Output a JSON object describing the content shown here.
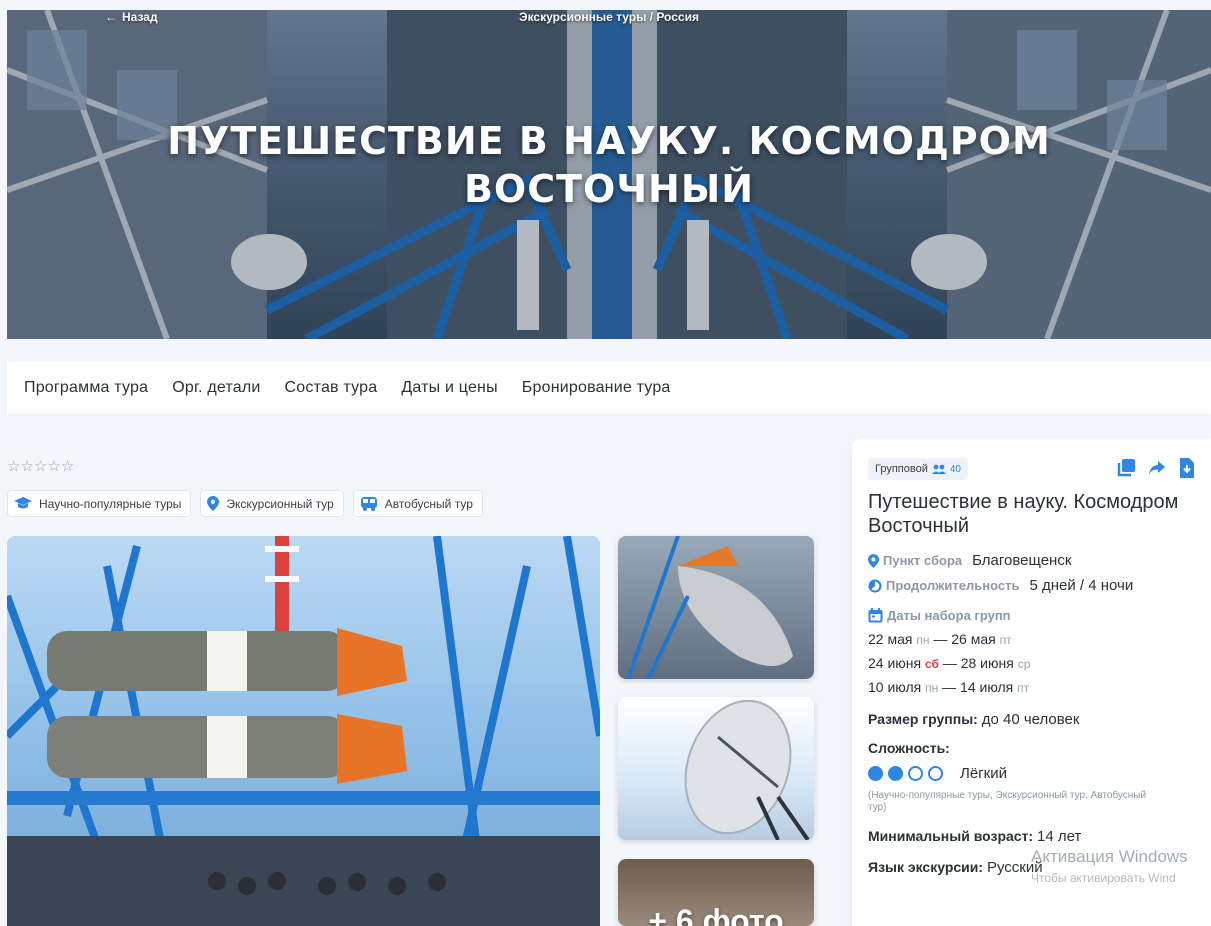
{
  "hero": {
    "back_label": "Назад",
    "breadcrumb": "Экскурсионные туры / Россия",
    "title": "ПУТЕШЕСТВИЕ В НАУКУ. КОСМОДРОМ ВОСТОЧНЫЙ"
  },
  "nav": {
    "items": [
      "Программа тура",
      "Орг. детали",
      "Состав тура",
      "Даты и цены",
      "Бронирование тура"
    ]
  },
  "rating": {
    "stars": "☆☆☆☆☆",
    "value": 0,
    "max": 5
  },
  "tags": [
    "Научно-популярные туры",
    "Экскурсионный тур",
    "Автобусный тур"
  ],
  "gallery": {
    "more_label": "+ 6 фото"
  },
  "panel": {
    "type_label": "Групповой",
    "group_count": "40",
    "title": "Путешествие в науку. Космодром Восточный",
    "meeting_label": "Пункт сбора",
    "meeting_value": "Благовещенск",
    "duration_label": "Продолжительность",
    "duration_value": "5 дней / 4 ночи",
    "dates_label": "Даты набора групп",
    "dates": [
      {
        "start": "22 мая",
        "start_dow": "пн",
        "end": "26 мая",
        "end_dow": "пт"
      },
      {
        "start": "24 июня",
        "start_dow": "сб",
        "end": "28 июня",
        "end_dow": "ср"
      },
      {
        "start": "10 июля",
        "start_dow": "пн",
        "end": "14 июля",
        "end_dow": "пт"
      }
    ],
    "dash": "—",
    "group_size_label": "Размер группы:",
    "group_size_value": "до 40 человек",
    "difficulty_label": "Сложность:",
    "difficulty_value": "Лёгкий",
    "difficulty_level": 2,
    "difficulty_max": 4,
    "categories_note": "(Научно-популярные туры, Экскурсионный тур, Автобусный тур)",
    "min_age_label": "Минимальный возраст:",
    "min_age_value": "14 лет",
    "language_label": "Язык экскурсии:",
    "language_value": "Русский"
  },
  "watermark": {
    "line1": "Активация Windows",
    "line2": "Чтобы активировать Wind"
  },
  "colors": {
    "accent": "#2f86e3",
    "weekend": "#e0413f",
    "text": "#2c3138",
    "muted": "#8d98a4"
  }
}
